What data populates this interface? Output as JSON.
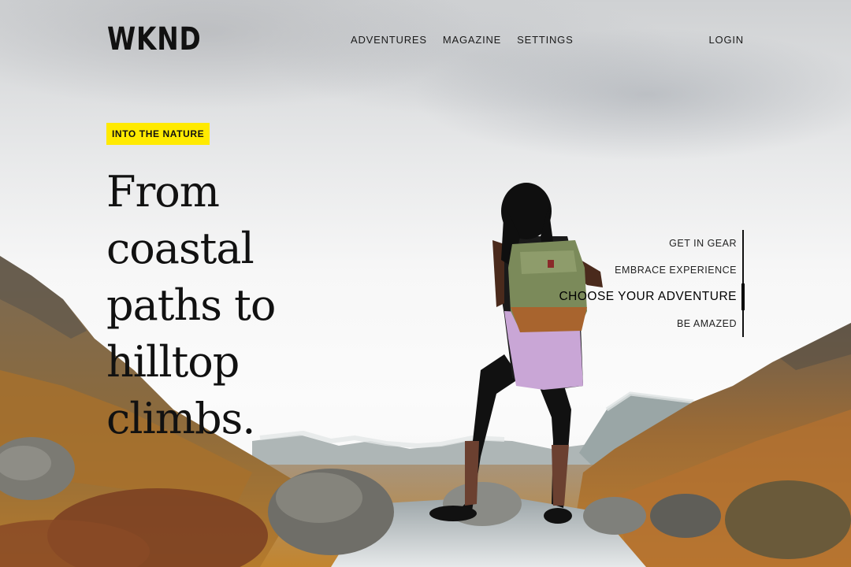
{
  "header": {
    "logo": "WKND",
    "nav": [
      "ADVENTURES",
      "MAGAZINE",
      "SETTINGS"
    ],
    "login_label": "LOGIN"
  },
  "hero": {
    "badge": "INTO THE NATURE",
    "headline": "From coastal paths to hilltop climbs.",
    "carousel_items": [
      {
        "label": "GET IN GEAR",
        "active": false
      },
      {
        "label": "EMBRACE EXPERIENCE",
        "active": false
      },
      {
        "label": "CHOOSE YOUR ADVENTURE",
        "active": true
      },
      {
        "label": "BE AMAZED",
        "active": false
      }
    ]
  },
  "colors": {
    "badge_bg": "#ffea00",
    "text": "#111111"
  }
}
